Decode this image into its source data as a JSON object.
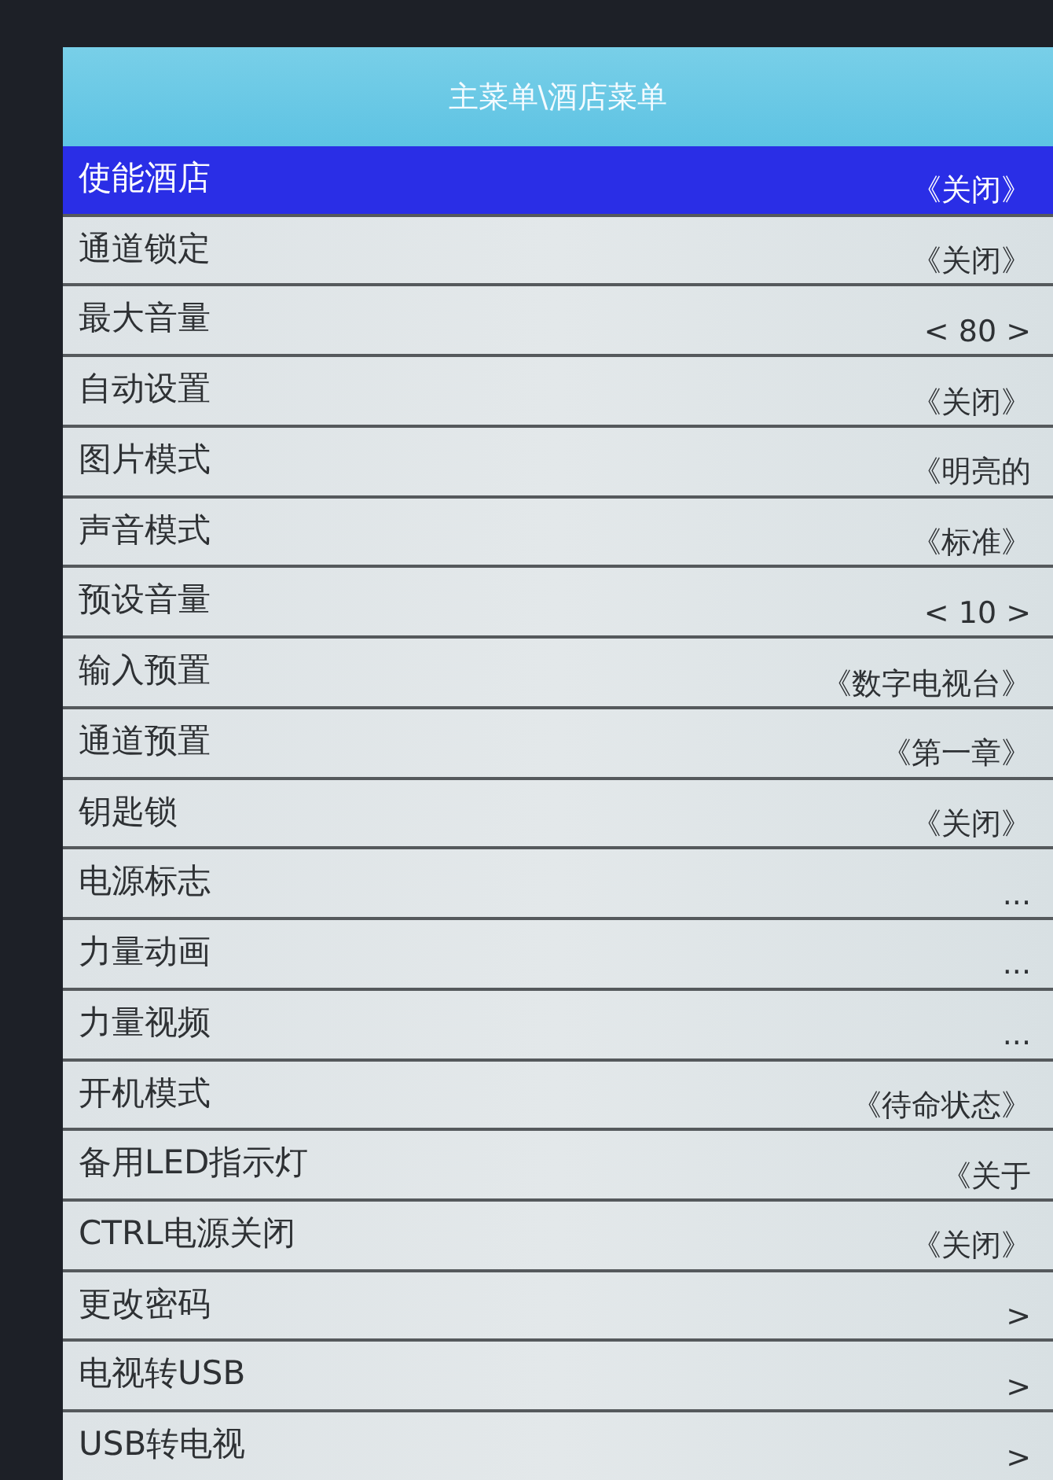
{
  "menu": {
    "title": "主菜单\\酒店菜单",
    "rows": [
      {
        "label": "使能酒店",
        "value": "《关闭》",
        "selected": true
      },
      {
        "label": "通道锁定",
        "value": "《关闭》",
        "selected": false
      },
      {
        "label": "最大音量",
        "value": "< 80 >",
        "selected": false
      },
      {
        "label": "自动设置",
        "value": "《关闭》",
        "selected": false
      },
      {
        "label": "图片模式",
        "value": "《明亮的",
        "selected": false
      },
      {
        "label": "声音模式",
        "value": "《标准》",
        "selected": false
      },
      {
        "label": "预设音量",
        "value": "< 10 >",
        "selected": false
      },
      {
        "label": "输入预置",
        "value": "《数字电视台》",
        "selected": false
      },
      {
        "label": "通道预置",
        "value": "《第一章》",
        "selected": false
      },
      {
        "label": "钥匙锁",
        "value": "《关闭》",
        "selected": false
      },
      {
        "label": "电源标志",
        "value": "...",
        "selected": false
      },
      {
        "label": "力量动画",
        "value": "...",
        "selected": false
      },
      {
        "label": "力量视频",
        "value": "...",
        "selected": false
      },
      {
        "label": "开机模式",
        "value": "《待命状态》",
        "selected": false
      },
      {
        "label": "备用LED指示灯",
        "value": "《关于",
        "selected": false
      },
      {
        "label": "CTRL电源关闭",
        "value": "《关闭》",
        "selected": false
      },
      {
        "label": "更改密码",
        "value": ">",
        "selected": false
      },
      {
        "label": "电视转USB",
        "value": ">",
        "selected": false
      },
      {
        "label": "USB转电视",
        "value": ">",
        "selected": false
      }
    ]
  }
}
